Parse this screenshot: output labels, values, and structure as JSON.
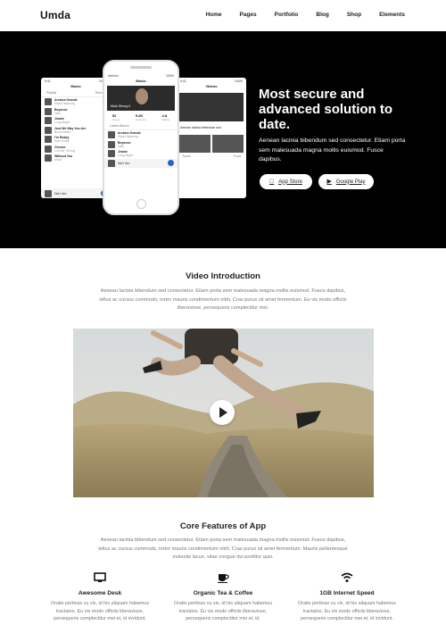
{
  "brand": "Umda",
  "nav": [
    "Home",
    "Pages",
    "Portfolio",
    "Blog",
    "Shop",
    "Elements"
  ],
  "hero": {
    "title": "Most secure and advanced solution to date.",
    "text": "Aenean lacinia bibendum sed consectetur. Etiam porta sem malesuada magna mollis euismod. Fusce dapibus.",
    "app_store": "App Store",
    "google_play": "Google Play"
  },
  "phones": {
    "left": {
      "status_left": "9:41",
      "status_right": "100%",
      "title": "Music",
      "tabs": [
        "Playlist",
        "Recent"
      ],
      "rows": [
        {
          "title": "Arctura Grande",
          "sub": "Rapid listening"
        },
        {
          "title": "Beyonce",
          "sub": "Halo"
        },
        {
          "title": "Jeanie",
          "sub": "Long Night"
        },
        {
          "title": "Just We Way You Are",
          "sub": "Bruno Mars"
        },
        {
          "title": "I'm Ready",
          "sub": "Sam Smith"
        },
        {
          "title": "Cheese",
          "sub": "Out the Timing"
        },
        {
          "title": "Without You",
          "sub": "Avicii"
        }
      ],
      "player": "Not I Am"
    },
    "center": {
      "status_left": "Verizon",
      "status_right": "100%",
      "title": "Music",
      "artist": "Mark Strong II",
      "stats": [
        {
          "value": "52",
          "label": "Songs"
        },
        {
          "value": "5.2K",
          "label": "Listeners"
        },
        {
          "value": "4.8",
          "label": "Rating"
        }
      ],
      "list_label": "Latest Albums",
      "rows": [
        {
          "title": "Arctura Grande",
          "sub": "Rapid listening"
        },
        {
          "title": "Beyonce",
          "sub": "Halo"
        },
        {
          "title": "Jeanie",
          "sub": "Long Night"
        }
      ],
      "player": "Not I Am"
    },
    "right": {
      "status_left": "9:41",
      "status_right": "100%",
      "title": "Videos",
      "caption": "Aenean lacinia bibendum sed",
      "tag_left": "Travel",
      "tag_right": "Food"
    }
  },
  "video_section": {
    "title": "Video Introduction",
    "text": "Aenean lacinia bibendum sed consectetur. Etiam porta sem malesuada magna mollis euismod. Fusce dapibus, tellus ac cursus commodo, tortor mauris condimentum nibh, Cras purus sit amet fermentum. Eu vis modo officiis liberavisse, persequeris complectitur mei."
  },
  "features_section": {
    "title": "Core Features of App",
    "text": "Aenean lacinia bibendum sed consectetur. Etiam porta sem malesuada magna mollis euismod. Fusce dapibus, tellus ac cursus commodo, tortor mauris condimentum nibh, Cras purus sit amet fermentum. Mauris pellentesque molestie lacus, vitae congue dui porttitor quis.",
    "items": [
      {
        "icon": "desktop-icon",
        "title": "Awesome Desk",
        "text": "Oratio pertinax cu vix, id his aliquam habemus tractatos. Eu vis modo officiis liberavisse, persequeris complectitur mei et, id invidunt."
      },
      {
        "icon": "coffee-cup-icon",
        "title": "Organic Tea & Coffee",
        "text": "Oratio pertinax cu vix, id his aliquam habemus tractatos. Eu vis modo officiis liberavisse, persequeris complectitur mei et, id."
      },
      {
        "icon": "wifi-icon",
        "title": "1GB Internet Speed",
        "text": "Oratio pertinax cu vix, id his aliquam habemus tractatos. Eu vis modo officiis liberavisse, persequeris complectitur mei et, id invidunt."
      }
    ]
  }
}
